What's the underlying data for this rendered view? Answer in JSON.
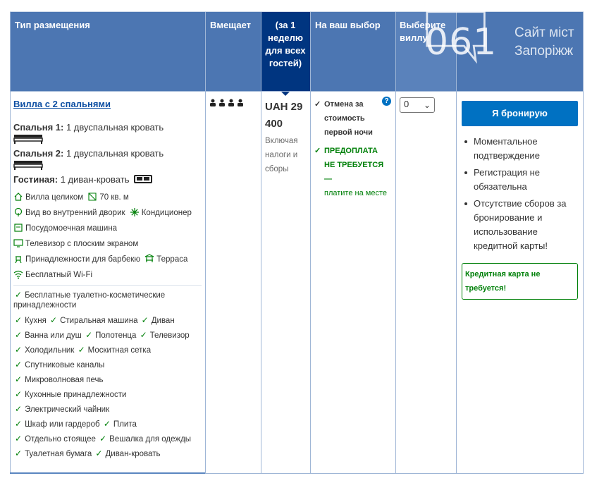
{
  "headers": {
    "type": "Тип размещения",
    "sleeps": "Вмещает",
    "price": "(за 1 неделю для всех гостей)",
    "choice": "На ваш выбор",
    "select": "Выберите виллу"
  },
  "room": {
    "name": "Вилла с 2 спальнями",
    "bedroom1_label": "Спальня 1:",
    "bedroom1_bed": "1 двуспальная кровать",
    "bedroom2_label": "Спальня 2:",
    "bedroom2_bed": "1 двуспальная кровать",
    "living_label": "Гостиная:",
    "living_bed": "1 диван-кровать",
    "facilities": {
      "entire_villa": "Вилла целиком",
      "size": "70 кв. м",
      "courtyard_view": "Вид во внутренний дворик",
      "aircon": "Кондиционер",
      "dishwasher": "Посудомоечная машина",
      "tv": "Телевизор с плоским экраном",
      "bbq": "Принадлежности для барбекю",
      "terrace": "Терраса",
      "wifi": "Бесплатный Wi-Fi"
    },
    "amenities": {
      "toiletries": "Бесплатные туалетно-косметические принадлежности",
      "kitchen": "Кухня",
      "washer": "Стиральная машина",
      "sofa": "Диван",
      "bath": "Ванна или душ",
      "towels": "Полотенца",
      "tv2": "Телевизор",
      "fridge": "Холодильник",
      "mosquito": "Москитная сетка",
      "satellite": "Спутниковые каналы",
      "microwave": "Микроволновая печь",
      "kitchenware": "Кухонные принадлежности",
      "kettle": "Электрический чайник",
      "wardrobe": "Шкаф или гардероб",
      "stove": "Плита",
      "toilet_separate": "Отдельно стоящее",
      "hanger": "Вешалка для одежды",
      "toilet_paper": "Туалетная бумага",
      "sofa_bed": "Диван-кровать"
    }
  },
  "sleeps": {
    "icons": "●●●●",
    "count": 4
  },
  "price": {
    "amount": "UAH 29 400",
    "note": "Включая налоги и сборы"
  },
  "choice": {
    "cancel": "Отмена за стоимость первой ночи",
    "prepay": "ПРЕДОПЛАТА НЕ ТРЕБУЕТСЯ —",
    "pay": "платите на месте",
    "help": "?"
  },
  "select": {
    "value": "0"
  },
  "booking": {
    "button": "Я бронирую",
    "benefits": [
      "Моментальное подтверждение",
      "Регистрация не обязательна",
      "Отсутствие сборов за бронирование и использование кредитной карты!"
    ],
    "no_card": "Кредитная карта не требуется!"
  },
  "watermark": {
    "number": "061",
    "line1": "Сайт міст",
    "line2": "Запоріжж"
  }
}
